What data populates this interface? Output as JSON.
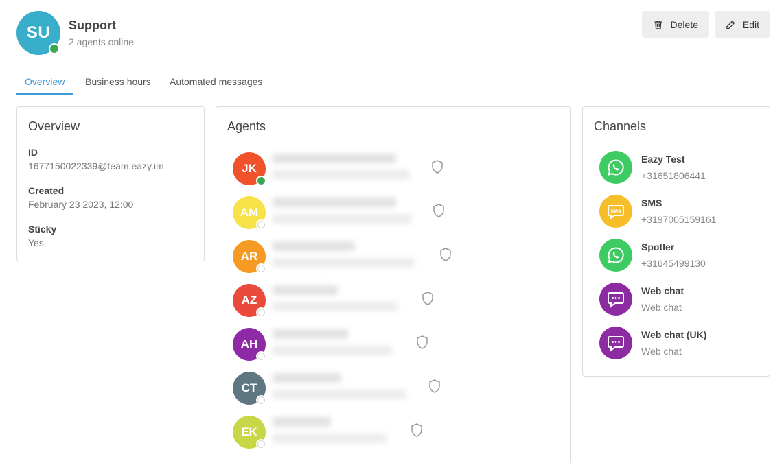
{
  "team": {
    "initials": "SU",
    "name": "Support",
    "agents_online": "2 agents online",
    "avatar_color": "#38aecb",
    "status_color": "#3aa852"
  },
  "actions": {
    "delete_label": "Delete",
    "edit_label": "Edit"
  },
  "tabs": [
    {
      "label": "Overview",
      "active": true
    },
    {
      "label": "Business hours",
      "active": false
    },
    {
      "label": "Automated messages",
      "active": false
    }
  ],
  "overview": {
    "title": "Overview",
    "fields": [
      {
        "label": "ID",
        "value": "1677150022339@team.eazy.im"
      },
      {
        "label": "Created",
        "value": "February 23 2023, 12:00"
      },
      {
        "label": "Sticky",
        "value": "Yes"
      }
    ]
  },
  "agents": {
    "title": "Agents",
    "items": [
      {
        "initials": "JK",
        "color": "#f0522c",
        "status": "online",
        "icon": "shield-icon"
      },
      {
        "initials": "AM",
        "color": "#f7e24a",
        "status": "offline",
        "icon": "shield-icon"
      },
      {
        "initials": "AR",
        "color": "#f59a23",
        "status": "offline",
        "icon": "shield-icon"
      },
      {
        "initials": "AZ",
        "color": "#ea4a3b",
        "status": "offline",
        "icon": "shield-icon"
      },
      {
        "initials": "AH",
        "color": "#8e2aa6",
        "status": "offline",
        "icon": "shield-icon"
      },
      {
        "initials": "CT",
        "color": "#5f7683",
        "status": "offline",
        "icon": "shield-icon"
      },
      {
        "initials": "EK",
        "color": "#c8d746",
        "status": "offline",
        "icon": "shield-icon"
      }
    ]
  },
  "channels": {
    "title": "Channels",
    "items": [
      {
        "name": "Eazy Test",
        "sub": "+31651806441",
        "type": "whatsapp",
        "color": "#3ecb63",
        "icon": "whatsapp-icon"
      },
      {
        "name": "SMS",
        "sub": "+3197005159161",
        "type": "sms",
        "color": "#f6bf2a",
        "icon": "sms-icon"
      },
      {
        "name": "Spotler",
        "sub": "+31645499130",
        "type": "whatsapp",
        "color": "#3ecb63",
        "icon": "whatsapp-icon"
      },
      {
        "name": "Web chat",
        "sub": "Web chat",
        "type": "webchat",
        "color": "#8d2ba3",
        "icon": "chat-bubble-icon"
      },
      {
        "name": "Web chat (UK)",
        "sub": "Web chat",
        "type": "webchat",
        "color": "#8d2ba3",
        "icon": "chat-bubble-icon"
      }
    ]
  }
}
